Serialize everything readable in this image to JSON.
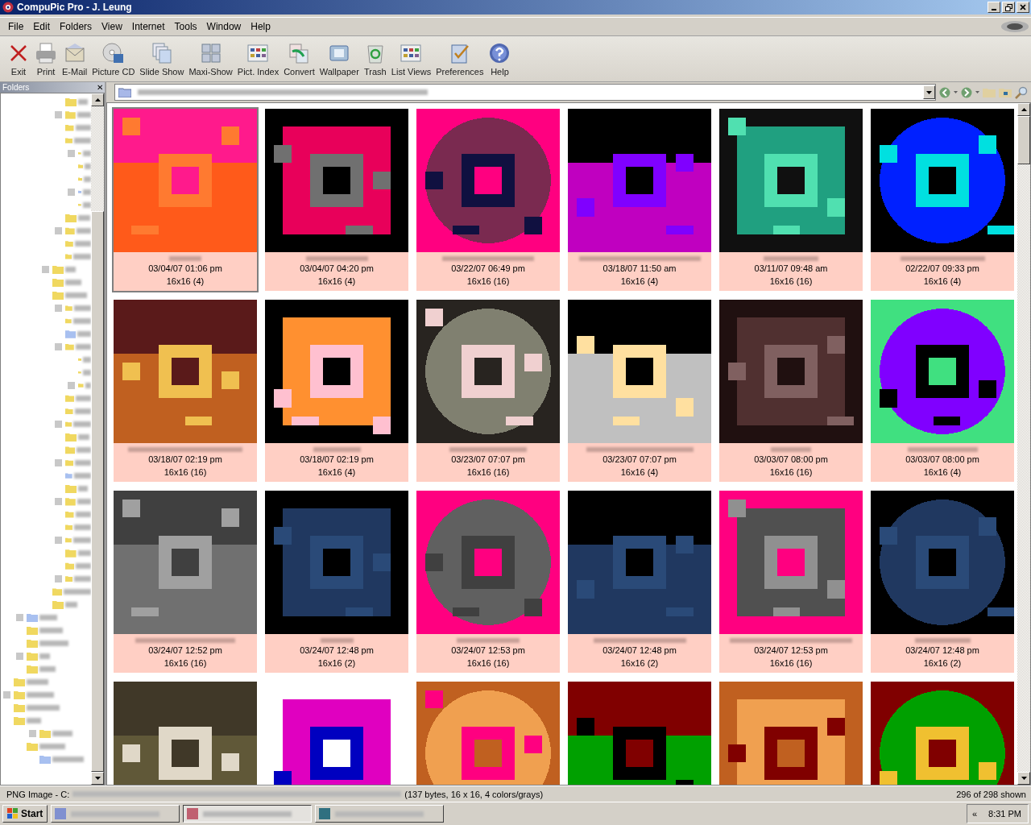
{
  "window": {
    "title": "CompuPic Pro - J. Leung"
  },
  "menu": [
    "File",
    "Edit",
    "Folders",
    "View",
    "Internet",
    "Tools",
    "Window",
    "Help"
  ],
  "toolbar": [
    {
      "label": "Exit",
      "kind": "exit"
    },
    {
      "label": "Print",
      "kind": "print"
    },
    {
      "label": "E-Mail",
      "kind": "mail"
    },
    {
      "label": "Picture CD",
      "kind": "cd"
    },
    {
      "label": "Slide Show",
      "kind": "slides"
    },
    {
      "label": "Maxi-Show",
      "kind": "maxi"
    },
    {
      "label": "Pict. Index",
      "kind": "index"
    },
    {
      "label": "Convert",
      "kind": "convert"
    },
    {
      "label": "Wallpaper",
      "kind": "wallpaper"
    },
    {
      "label": "Trash",
      "kind": "trash"
    },
    {
      "label": "List Views",
      "kind": "list"
    },
    {
      "label": "Preferences",
      "kind": "prefs"
    },
    {
      "label": "Help",
      "kind": "help"
    }
  ],
  "folders_panel": {
    "title": "Folders",
    "close": "✕"
  },
  "thumbnails": [
    {
      "date": "03/04/07 01:06 pm",
      "size": "16x16 (4)",
      "selected": true
    },
    {
      "date": "03/04/07 04:20 pm",
      "size": "16x16 (4)",
      "selected": false
    },
    {
      "date": "03/22/07 06:49 pm",
      "size": "16x16 (16)",
      "selected": false
    },
    {
      "date": "03/18/07 11:50 am",
      "size": "16x16 (4)",
      "selected": false
    },
    {
      "date": "03/11/07 09:48 am",
      "size": "16x16 (16)",
      "selected": false
    },
    {
      "date": "02/22/07 09:33 pm",
      "size": "16x16 (4)",
      "selected": false
    },
    {
      "date": "03/18/07 02:19 pm",
      "size": "16x16 (16)",
      "selected": false
    },
    {
      "date": "03/18/07 02:19 pm",
      "size": "16x16 (4)",
      "selected": false
    },
    {
      "date": "03/23/07 07:07 pm",
      "size": "16x16 (16)",
      "selected": false
    },
    {
      "date": "03/23/07 07:07 pm",
      "size": "16x16 (4)",
      "selected": false
    },
    {
      "date": "03/03/07 08:00 pm",
      "size": "16x16 (16)",
      "selected": false
    },
    {
      "date": "03/03/07 08:00 pm",
      "size": "16x16 (4)",
      "selected": false
    },
    {
      "date": "03/24/07 12:52 pm",
      "size": "16x16 (16)",
      "selected": false
    },
    {
      "date": "03/24/07 12:48 pm",
      "size": "16x16 (2)",
      "selected": false
    },
    {
      "date": "03/24/07 12:53 pm",
      "size": "16x16 (16)",
      "selected": false
    },
    {
      "date": "03/24/07 12:48 pm",
      "size": "16x16 (2)",
      "selected": false
    },
    {
      "date": "03/24/07 12:53 pm",
      "size": "16x16 (16)",
      "selected": false
    },
    {
      "date": "03/24/07 12:48 pm",
      "size": "16x16 (2)",
      "selected": false
    },
    {
      "selected": false
    },
    {
      "selected": false
    },
    {
      "selected": false
    },
    {
      "selected": false
    },
    {
      "selected": false
    },
    {
      "selected": false
    }
  ],
  "status_bar": {
    "file_type": "PNG Image - C:",
    "info": "(137 bytes, 16 x 16, 4 colors/grays)",
    "count": "296 of 298 shown"
  },
  "taskbar": {
    "start": "Start",
    "tasks": [
      {
        "selected": false
      },
      {
        "selected": true
      },
      {
        "selected": false
      }
    ],
    "tray_toggle": "«",
    "clock": "8:31 PM"
  }
}
